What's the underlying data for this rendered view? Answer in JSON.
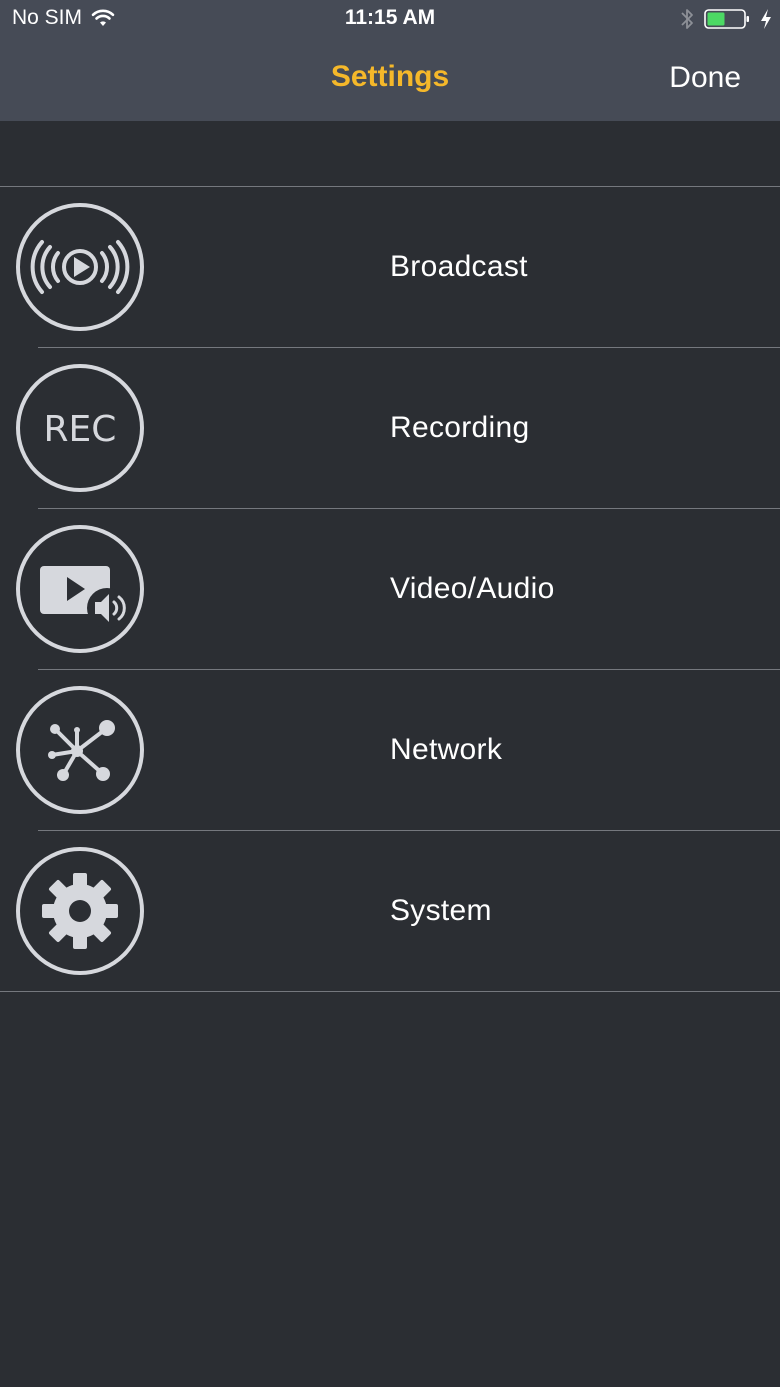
{
  "status_bar": {
    "carrier": "No SIM",
    "time": "11:15 AM"
  },
  "nav": {
    "title": "Settings",
    "done_label": "Done"
  },
  "menu": {
    "items": [
      {
        "label": "Broadcast",
        "icon": "broadcast-icon"
      },
      {
        "label": "Recording",
        "icon": "rec-icon",
        "icon_text": "REC"
      },
      {
        "label": "Video/Audio",
        "icon": "video-audio-icon"
      },
      {
        "label": "Network",
        "icon": "network-icon"
      },
      {
        "label": "System",
        "icon": "gear-icon"
      }
    ]
  },
  "colors": {
    "background": "#2b2e33",
    "header": "#464b56",
    "title_accent": "#f5b82a",
    "icon_stroke": "#d6d8dd",
    "separator": "#75787e",
    "battery_fill": "#4cd964"
  }
}
